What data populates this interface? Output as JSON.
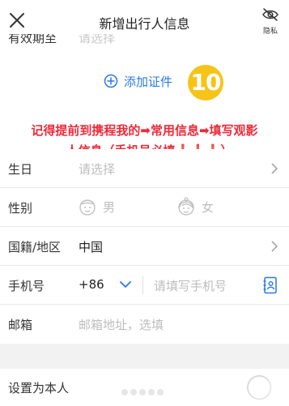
{
  "header": {
    "title": "新增出行人信息",
    "privacy_label": "隐私"
  },
  "cut_row": {
    "label": "有效期至",
    "placeholder": "请选择"
  },
  "add_cert": {
    "label": "添加证件"
  },
  "annotation": {
    "badge": "10",
    "line1": "记得提前到携程我的➡常用信息➡填写观影",
    "line2": "人信息（手机号必填❗❗❗）"
  },
  "form": {
    "birthday": {
      "label": "生日",
      "placeholder": "请选择"
    },
    "gender": {
      "label": "性别",
      "male": "男",
      "female": "女"
    },
    "nationality": {
      "label": "国籍/地区",
      "value": "中国"
    },
    "phone": {
      "label": "手机号",
      "code": "+86",
      "placeholder": "请填写手机号"
    },
    "email": {
      "label": "邮箱",
      "placeholder": "邮箱地址，选填"
    }
  },
  "self": {
    "label": "设置为本人"
  },
  "colors": {
    "accent": "#2a78e4",
    "annotation": "#ee2a3a",
    "badge": "#f6c419"
  }
}
